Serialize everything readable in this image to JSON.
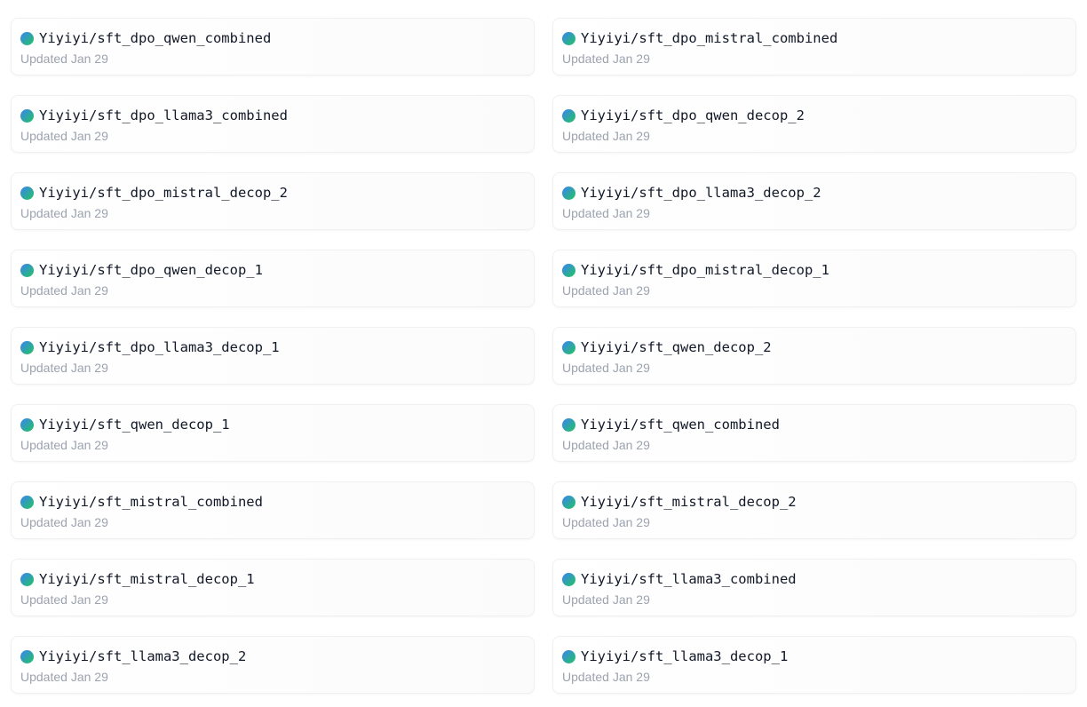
{
  "items": [
    {
      "name": "Yiyiyi/sft_dpo_qwen_combined",
      "updated": "Updated Jan 29"
    },
    {
      "name": "Yiyiyi/sft_dpo_mistral_combined",
      "updated": "Updated Jan 29"
    },
    {
      "name": "Yiyiyi/sft_dpo_llama3_combined",
      "updated": "Updated Jan 29"
    },
    {
      "name": "Yiyiyi/sft_dpo_qwen_decop_2",
      "updated": "Updated Jan 29"
    },
    {
      "name": "Yiyiyi/sft_dpo_mistral_decop_2",
      "updated": "Updated Jan 29"
    },
    {
      "name": "Yiyiyi/sft_dpo_llama3_decop_2",
      "updated": "Updated Jan 29"
    },
    {
      "name": "Yiyiyi/sft_dpo_qwen_decop_1",
      "updated": "Updated Jan 29"
    },
    {
      "name": "Yiyiyi/sft_dpo_mistral_decop_1",
      "updated": "Updated Jan 29"
    },
    {
      "name": "Yiyiyi/sft_dpo_llama3_decop_1",
      "updated": "Updated Jan 29"
    },
    {
      "name": "Yiyiyi/sft_qwen_decop_2",
      "updated": "Updated Jan 29"
    },
    {
      "name": "Yiyiyi/sft_qwen_decop_1",
      "updated": "Updated Jan 29"
    },
    {
      "name": "Yiyiyi/sft_qwen_combined",
      "updated": "Updated Jan 29"
    },
    {
      "name": "Yiyiyi/sft_mistral_combined",
      "updated": "Updated Jan 29"
    },
    {
      "name": "Yiyiyi/sft_mistral_decop_2",
      "updated": "Updated Jan 29"
    },
    {
      "name": "Yiyiyi/sft_mistral_decop_1",
      "updated": "Updated Jan 29"
    },
    {
      "name": "Yiyiyi/sft_llama3_combined",
      "updated": "Updated Jan 29"
    },
    {
      "name": "Yiyiyi/sft_llama3_decop_2",
      "updated": "Updated Jan 29"
    },
    {
      "name": "Yiyiyi/sft_llama3_decop_1",
      "updated": "Updated Jan 29"
    }
  ],
  "avatar_gradient": [
    "#3b82f6",
    "#22c55e"
  ]
}
